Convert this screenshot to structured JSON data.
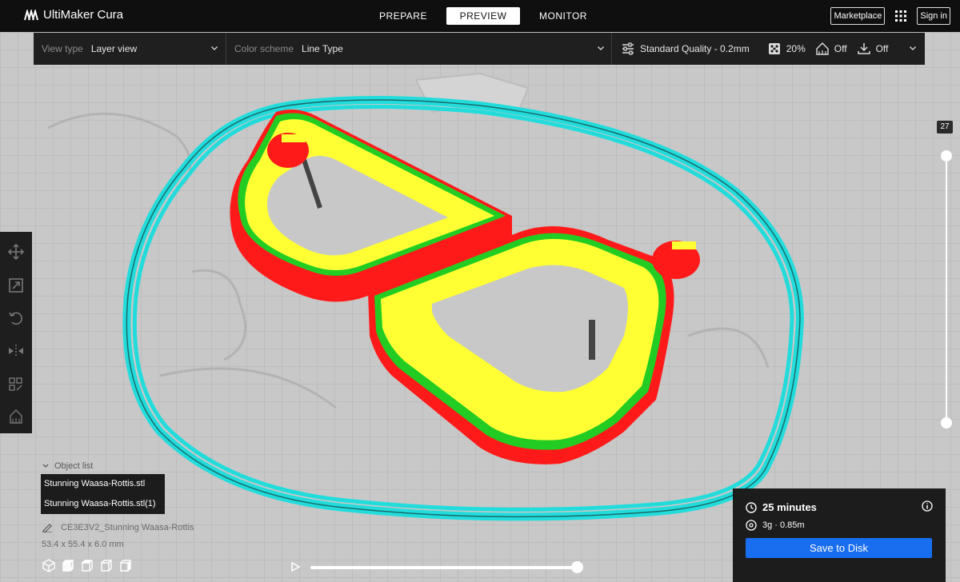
{
  "app": {
    "name": "UltiMaker Cura"
  },
  "stages": [
    {
      "label": "PREPARE",
      "active": false
    },
    {
      "label": "PREVIEW",
      "active": true
    },
    {
      "label": "MONITOR",
      "active": false
    }
  ],
  "header": {
    "marketplace_label": "Marketplace",
    "signin_label": "Sign in"
  },
  "toolbar": {
    "view_type_label": "View type",
    "view_type_value": "Layer view",
    "color_scheme_label": "Color scheme",
    "color_scheme_value": "Line Type",
    "quality": "Standard Quality - 0.2mm",
    "infill": "20%",
    "support": "Off",
    "adhesion": "Off"
  },
  "layer": {
    "current": "27"
  },
  "objects": {
    "header": "Object list",
    "items": [
      "Stunning Waasa-Rottis.stl",
      "Stunning Waasa-Rottis.stl(1)"
    ],
    "name": "CE3E3V2_Stunning Waasa-Rottis",
    "dimensions": "53.4 x 55.4 x 6.0 mm"
  },
  "estimate": {
    "time": "25 minutes",
    "material": "3g · 0.85m",
    "save_label": "Save to Disk"
  },
  "icons": [
    "logo-icon",
    "apps-grid-icon",
    "chevron-down-icon",
    "settings-sliders-icon",
    "infill-icon",
    "support-icon",
    "adhesion-icon",
    "move-icon",
    "scale-icon",
    "rotate-icon",
    "mirror-icon",
    "per-model-settings-icon",
    "support-blocker-icon",
    "clock-icon",
    "spool-icon",
    "info-icon",
    "play-icon",
    "view-3d-icon",
    "view-front-icon",
    "view-top-icon",
    "view-left-icon",
    "view-right-icon"
  ],
  "colors": {
    "wall_outer": "#ff1a1a",
    "wall_inner": "#22cc22",
    "infill": "#ffff33",
    "skirt": "#22dcdc",
    "accent": "#196ef0",
    "topbar": "#0f0f0f"
  }
}
